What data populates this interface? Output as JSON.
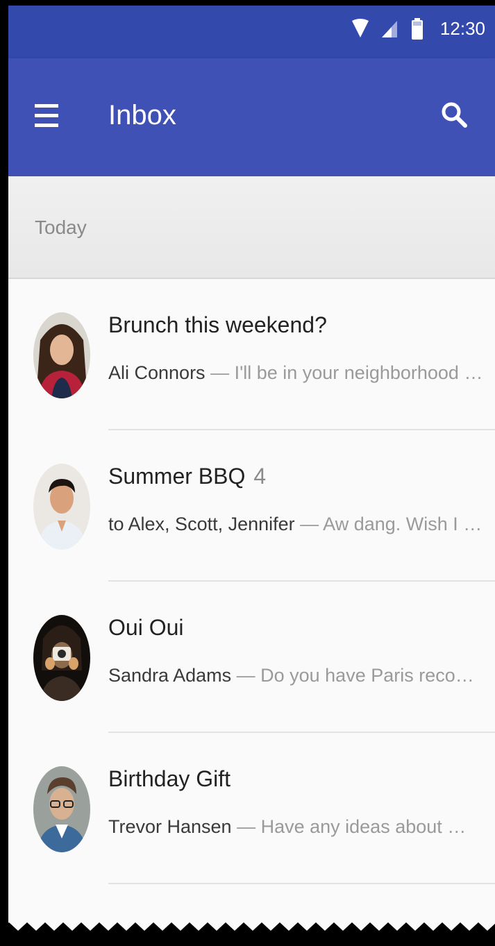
{
  "status_bar": {
    "time": "12:30"
  },
  "app_bar": {
    "title": "Inbox",
    "menu_icon": "hamburger-menu-icon",
    "search_icon": "search-icon"
  },
  "section": {
    "label": "Today"
  },
  "emails": [
    {
      "subject": "Brunch this weekend?",
      "count": "",
      "sender": "Ali Connors",
      "preview": " — I'll be in your neighborhood …"
    },
    {
      "subject": "Summer BBQ",
      "count": "4",
      "sender": "to Alex, Scott, Jennifer",
      "preview": " — Aw dang. Wish I …"
    },
    {
      "subject": "Oui Oui",
      "count": "",
      "sender": "Sandra Adams",
      "preview": " — Do you have Paris reco…"
    },
    {
      "subject": "Birthday Gift",
      "count": "",
      "sender": "Trevor Hansen",
      "preview": " — Have any ideas about …"
    }
  ],
  "colors": {
    "primary": "#3f51b5",
    "primary_dark": "#3449ac",
    "background": "#fafafa"
  }
}
